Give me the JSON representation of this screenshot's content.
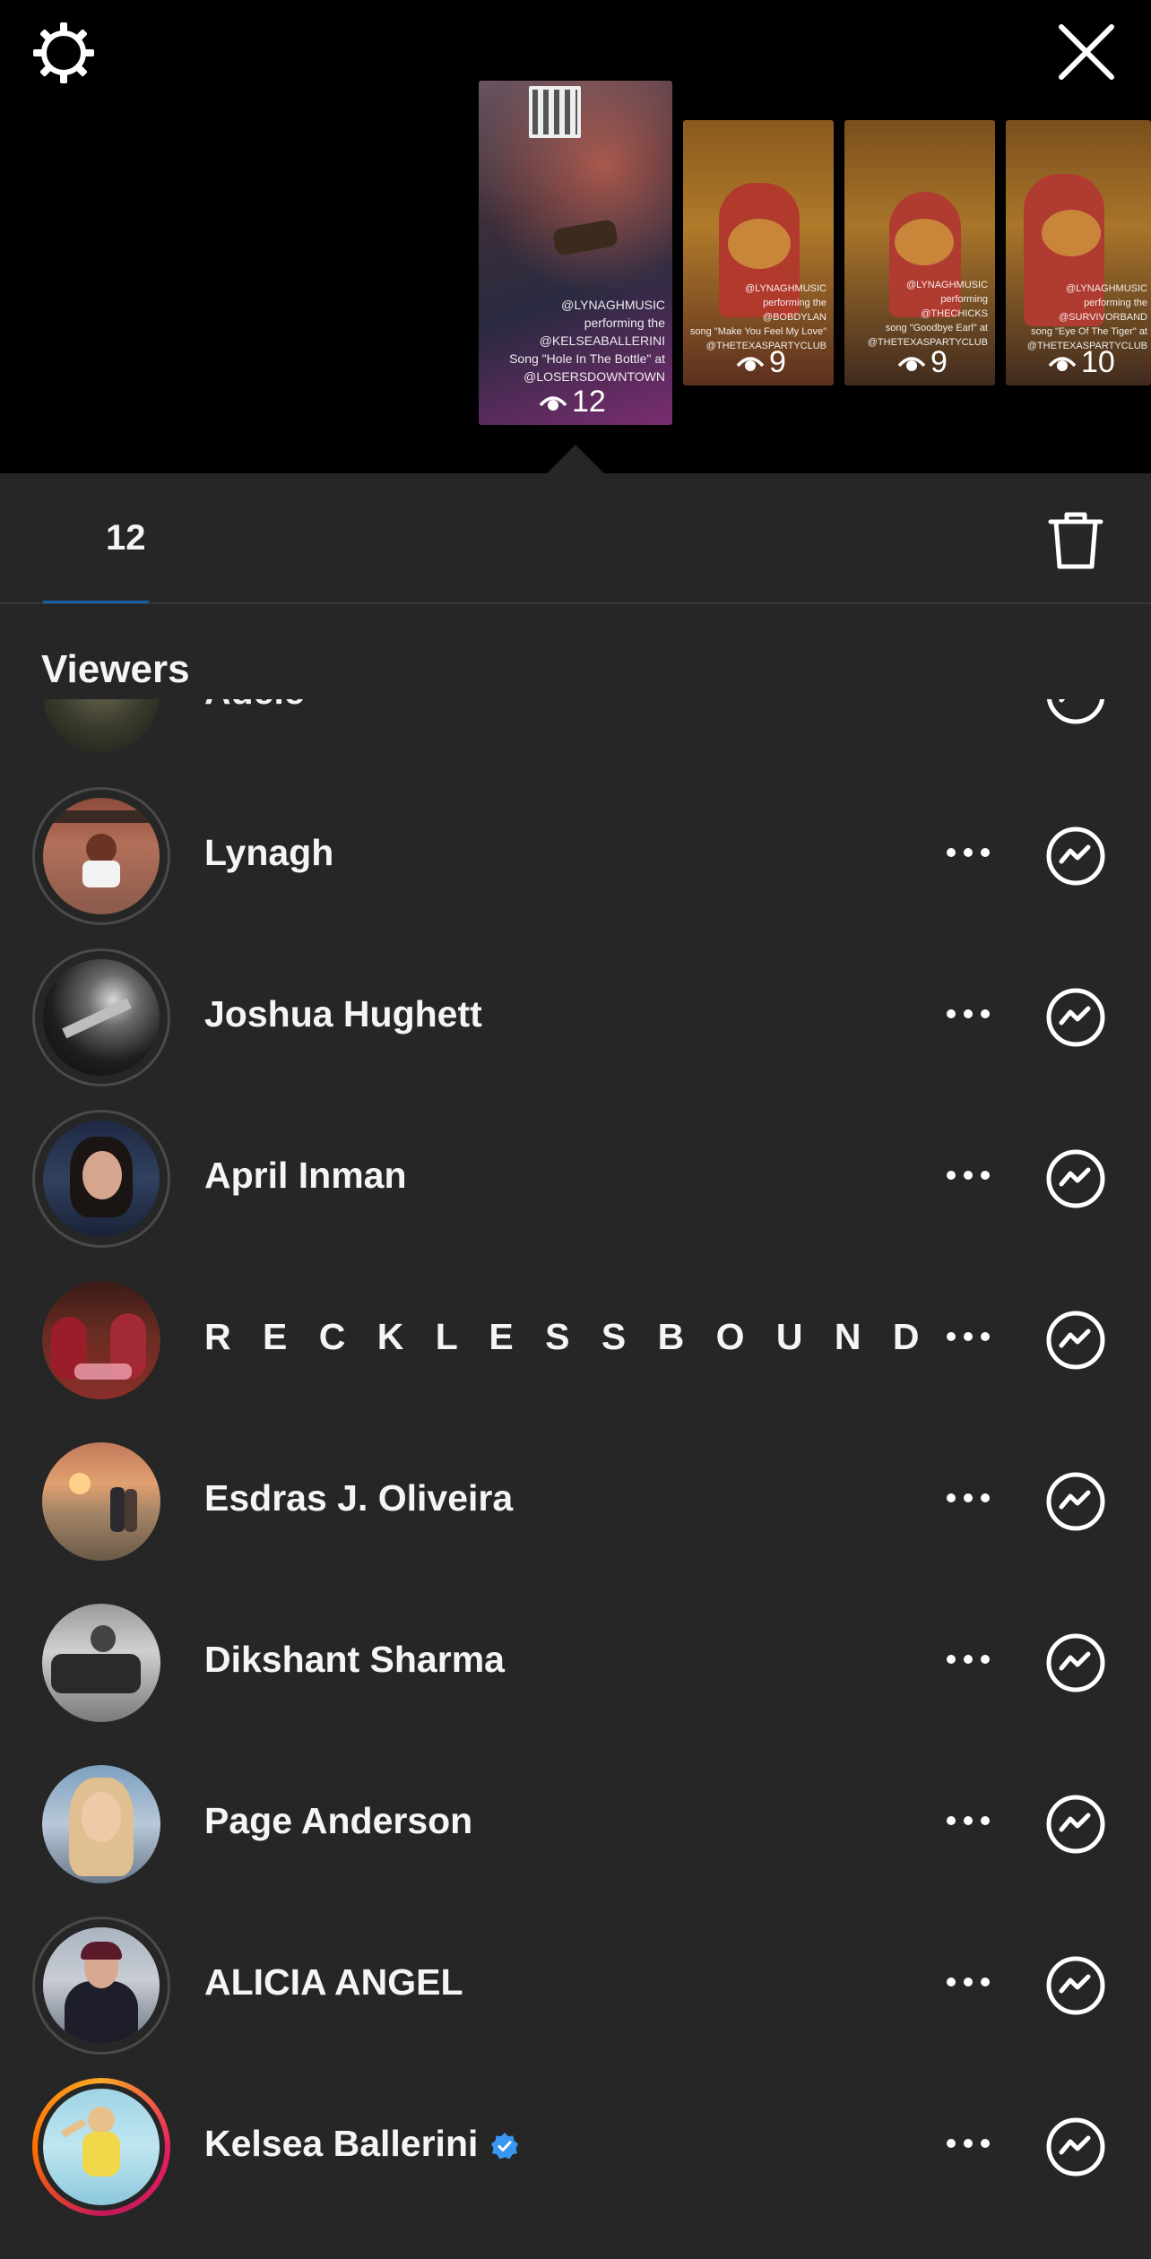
{
  "header": {
    "settings_icon": "gear-icon",
    "close_icon": "close-icon"
  },
  "stories": [
    {
      "views": "12",
      "caption": [
        "@LYNAGHMUSIC",
        "performing the",
        "@KELSEABALLERINI",
        "Song \"Hole In The Bottle\" at",
        "@LOSERSDOWNTOWN"
      ],
      "selected": true
    },
    {
      "views": "9",
      "caption": [
        "@LYNAGHMUSIC",
        "performing the",
        "@BOBDYLAN",
        "song \"Make You Feel My Love\"",
        "@THETEXASPARTYCLUB"
      ]
    },
    {
      "views": "9",
      "caption": [
        "@LYNAGHMUSIC",
        "performing",
        "@THECHICKS",
        "song \"Goodbye Earl\" at",
        "@THETEXASPARTYCLUB"
      ]
    },
    {
      "views": "10",
      "caption": [
        "@LYNAGHMUSIC",
        "performing the",
        "@SURVIVORBAND",
        "song \"Eye Of The Tiger\" at",
        "@THETEXASPARTYCLUB"
      ]
    }
  ],
  "stats": {
    "view_count": "12",
    "delete_icon": "trash-icon"
  },
  "viewers": {
    "title": "Viewers",
    "items": [
      {
        "name": "Adele"
      },
      {
        "name": "Lynagh"
      },
      {
        "name": "Joshua Hughett"
      },
      {
        "name": "April Inman"
      },
      {
        "name": "R E C K L E S S  B O U N D"
      },
      {
        "name": "Esdras J. Oliveira"
      },
      {
        "name": "Dikshant Sharma"
      },
      {
        "name": "Page Anderson"
      },
      {
        "name": "ALICIA ANGEL"
      },
      {
        "name": "Kelsea Ballerini",
        "verified": true
      }
    ]
  },
  "colors": {
    "background": "#262626",
    "top_bar": "#000000",
    "verified": "#3897f0"
  }
}
